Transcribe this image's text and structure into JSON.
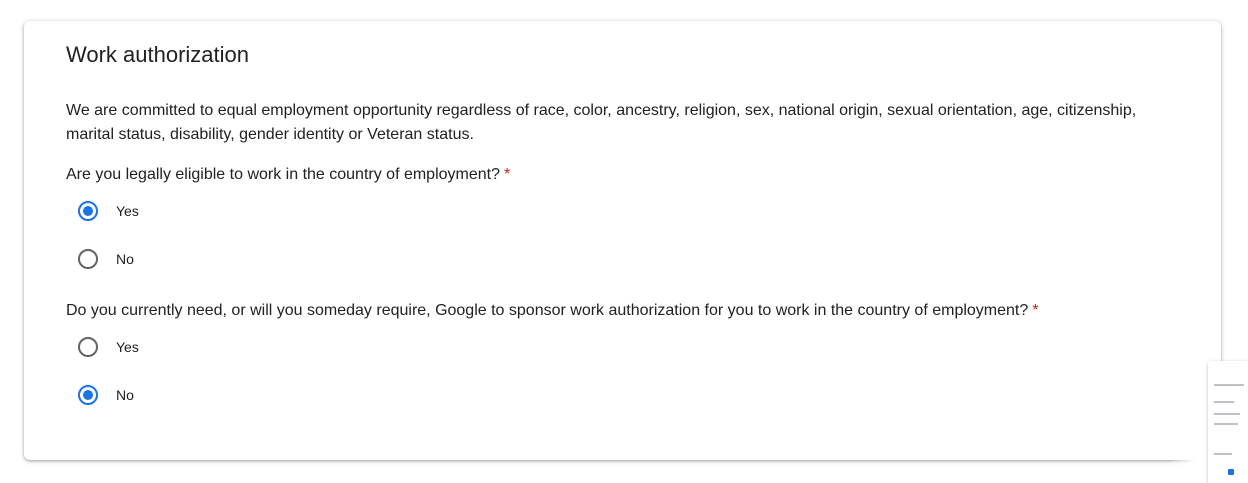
{
  "section": {
    "title": "Work authorization",
    "description": "We are committed to equal employment opportunity regardless of race, color, ancestry, religion, sex, national origin, sexual orientation, age, citizenship, marital status, disability, gender identity or Veteran status."
  },
  "questions": [
    {
      "text": "Are you legally eligible to work in the country of employment?",
      "required_mark": "*",
      "options": [
        {
          "label": "Yes",
          "selected": true
        },
        {
          "label": "No",
          "selected": false
        }
      ]
    },
    {
      "text": "Do you currently need, or will you someday require, Google to sponsor work authorization for you to work in the country of employment?",
      "required_mark": "*",
      "options": [
        {
          "label": "Yes",
          "selected": false
        },
        {
          "label": "No",
          "selected": true
        }
      ]
    }
  ],
  "colors": {
    "accent": "#1a73e8",
    "required": "#c5221f",
    "text": "#202124"
  }
}
